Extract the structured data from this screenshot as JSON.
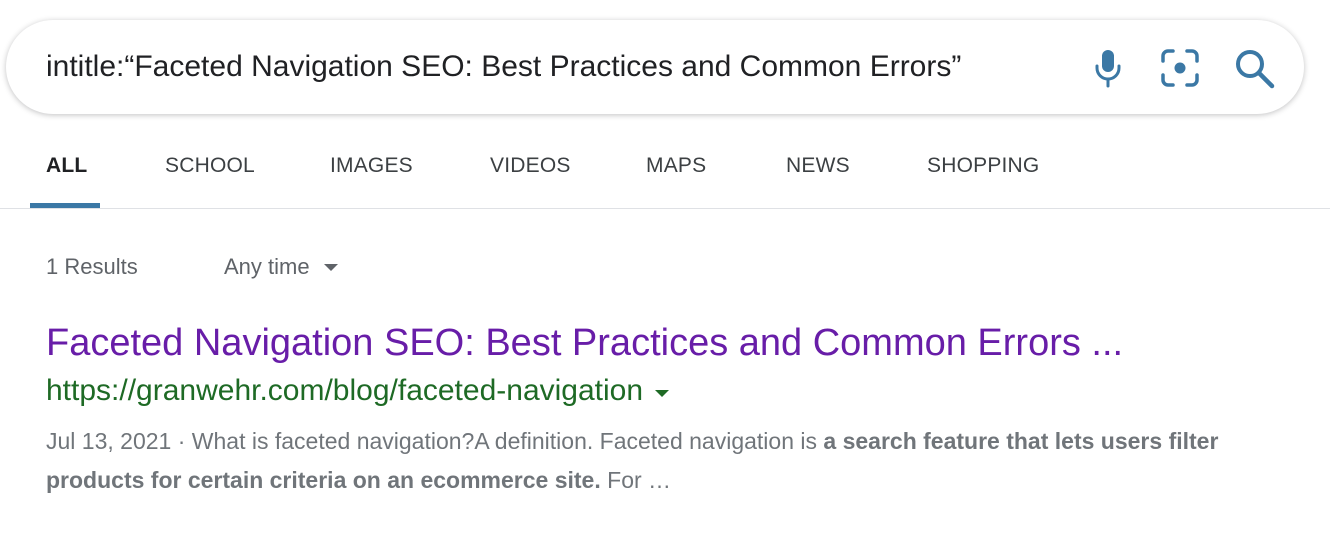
{
  "search": {
    "query": "intitle:“Faceted Navigation SEO: Best Practices and Common Errors”",
    "icons": [
      "microphone-icon",
      "lens-icon",
      "search-icon"
    ],
    "icon_color": "#3b78a5"
  },
  "tabs": [
    {
      "label": "ALL",
      "active": true
    },
    {
      "label": "SCHOOL",
      "active": false
    },
    {
      "label": "IMAGES",
      "active": false
    },
    {
      "label": "VIDEOS",
      "active": false
    },
    {
      "label": "MAPS",
      "active": false
    },
    {
      "label": "NEWS",
      "active": false
    },
    {
      "label": "SHOPPING",
      "active": false
    }
  ],
  "results_meta": {
    "count_text": "1 Results",
    "time_filter": "Any time"
  },
  "result": {
    "title": "Faceted Navigation SEO: Best Practices and Common Errors ...",
    "url": "https://granwehr.com/blog/faceted-navigation",
    "snippet_date": "Jul 13, 2021",
    "snippet_separator": " · ",
    "snippet_lead": "What is faceted navigation?A definition. Faceted navigation is ",
    "snippet_bold": "a search feature that lets users filter products for certain criteria on an ecommerce site.",
    "snippet_tail": " For …"
  },
  "colors": {
    "title_visited": "#681da8",
    "url_green": "#1e6a25",
    "tab_accent": "#3b78a5",
    "snippet_gray": "#70757a"
  }
}
